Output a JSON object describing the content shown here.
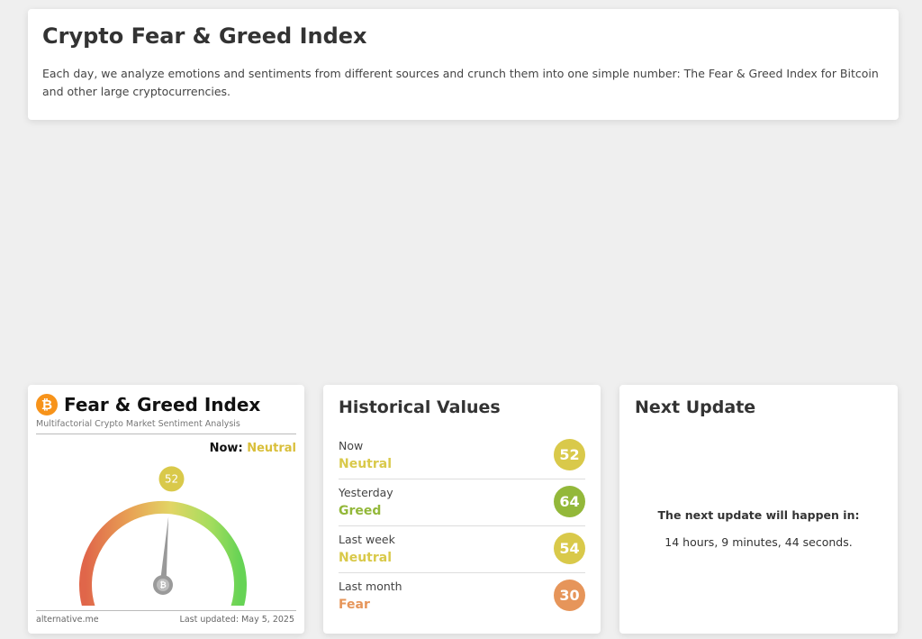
{
  "intro": {
    "title": "Crypto Fear & Greed Index",
    "description": "Each day, we analyze emotions and sentiments from different sources and crunch them into one simple number: The Fear & Greed Index for Bitcoin and other large cryptocurrencies."
  },
  "widget": {
    "logo_icon": "bitcoin-icon",
    "logo_glyph": "₿",
    "title": "Fear & Greed Index",
    "subtitle": "Multifactorial Crypto Market Sentiment Analysis",
    "now_label": "Now:",
    "now_value": "Neutral",
    "gauge_value": 52,
    "gauge_value_text": "52",
    "gauge_min": 0,
    "gauge_max": 100,
    "footer_source": "alternative.me",
    "footer_updated": "Last updated: May 5, 2025"
  },
  "historical": {
    "title": "Historical Values",
    "rows": [
      {
        "label": "Now",
        "classification": "Neutral",
        "value": "52",
        "color": "#d9c94a"
      },
      {
        "label": "Yesterday",
        "classification": "Greed",
        "value": "64",
        "color": "#93b83a"
      },
      {
        "label": "Last week",
        "classification": "Neutral",
        "value": "54",
        "color": "#d9c94a"
      },
      {
        "label": "Last month",
        "classification": "Fear",
        "value": "30",
        "color": "#e6955a"
      }
    ]
  },
  "next_update": {
    "title": "Next Update",
    "label": "The next update will happen in:",
    "countdown": "14 hours, 9 minutes, 44 seconds."
  },
  "colors": {
    "neutral": "#d9c94a",
    "greed": "#93b83a",
    "fear": "#e6955a",
    "bitcoin": "#f7931a"
  }
}
